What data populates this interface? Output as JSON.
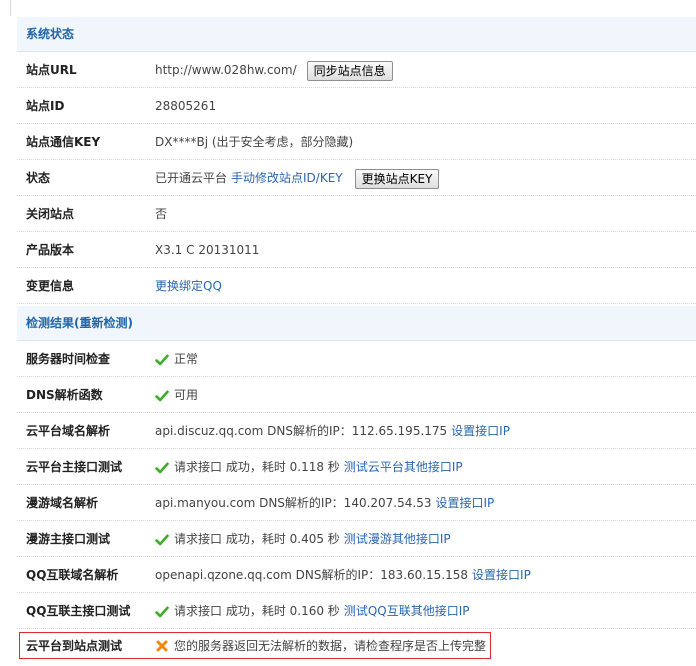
{
  "site_status_section": "系统状态",
  "rows": {
    "site_url": {
      "label": "站点URL",
      "value": "http://www.028hw.com/",
      "button": "同步站点信息"
    },
    "site_id": {
      "label": "站点ID",
      "value": "28805261"
    },
    "site_key": {
      "label": "站点通信KEY",
      "value": "DX****Bj (出于安全考虑，部分隐藏)"
    },
    "status": {
      "label": "状态",
      "value": "已开通云平台",
      "link": "手动修改站点ID/KEY",
      "button": "更换站点KEY"
    },
    "close_site": {
      "label": "关闭站点",
      "value": "否"
    },
    "product_version": {
      "label": "产品版本",
      "value": "X3.1 C 20131011"
    },
    "change_info": {
      "label": "变更信息",
      "link": "更换绑定QQ"
    }
  },
  "check_section": {
    "title": "检测结果",
    "recheck_link": "(重新检测)"
  },
  "checks": {
    "server_time": {
      "label": "服务器时间检查",
      "result": "正常"
    },
    "dns_func": {
      "label": "DNS解析函数",
      "result": "可用"
    },
    "cloud_dns": {
      "label": "云平台域名解析",
      "text": "api.discuz.qq.com DNS解析的IP：112.65.195.175",
      "link": "设置接口IP"
    },
    "cloud_api": {
      "label": "云平台主接口测试",
      "text": "请求接口 成功，耗时 0.118 秒",
      "link": "测试云平台其他接口IP"
    },
    "manyou_dns": {
      "label": "漫游域名解析",
      "text": "api.manyou.com DNS解析的IP：140.207.54.53",
      "link": "设置接口IP"
    },
    "manyou_api": {
      "label": "漫游主接口测试",
      "text": "请求接口 成功，耗时 0.405 秒",
      "link": "测试漫游其他接口IP"
    },
    "qq_dns": {
      "label": "QQ互联域名解析",
      "text": "openapi.qzone.qq.com DNS解析的IP：183.60.15.158",
      "link": "设置接口IP"
    },
    "qq_api": {
      "label": "QQ互联主接口测试",
      "text": "请求接口 成功，耗时 0.160 秒",
      "link": "测试QQ互联其他接口IP"
    },
    "cloud_to_site": {
      "label": "云平台到站点测试",
      "text": "您的服务器返回无法解析的数据，请检查程序是否上传完整"
    }
  },
  "colors": {
    "link": "#2a66b0",
    "section_bg": "#f0f6fb",
    "section_title": "#2366a8",
    "ok": "#3fae2a",
    "fail": "#f0870f",
    "highlight_border": "#e12a2a"
  }
}
